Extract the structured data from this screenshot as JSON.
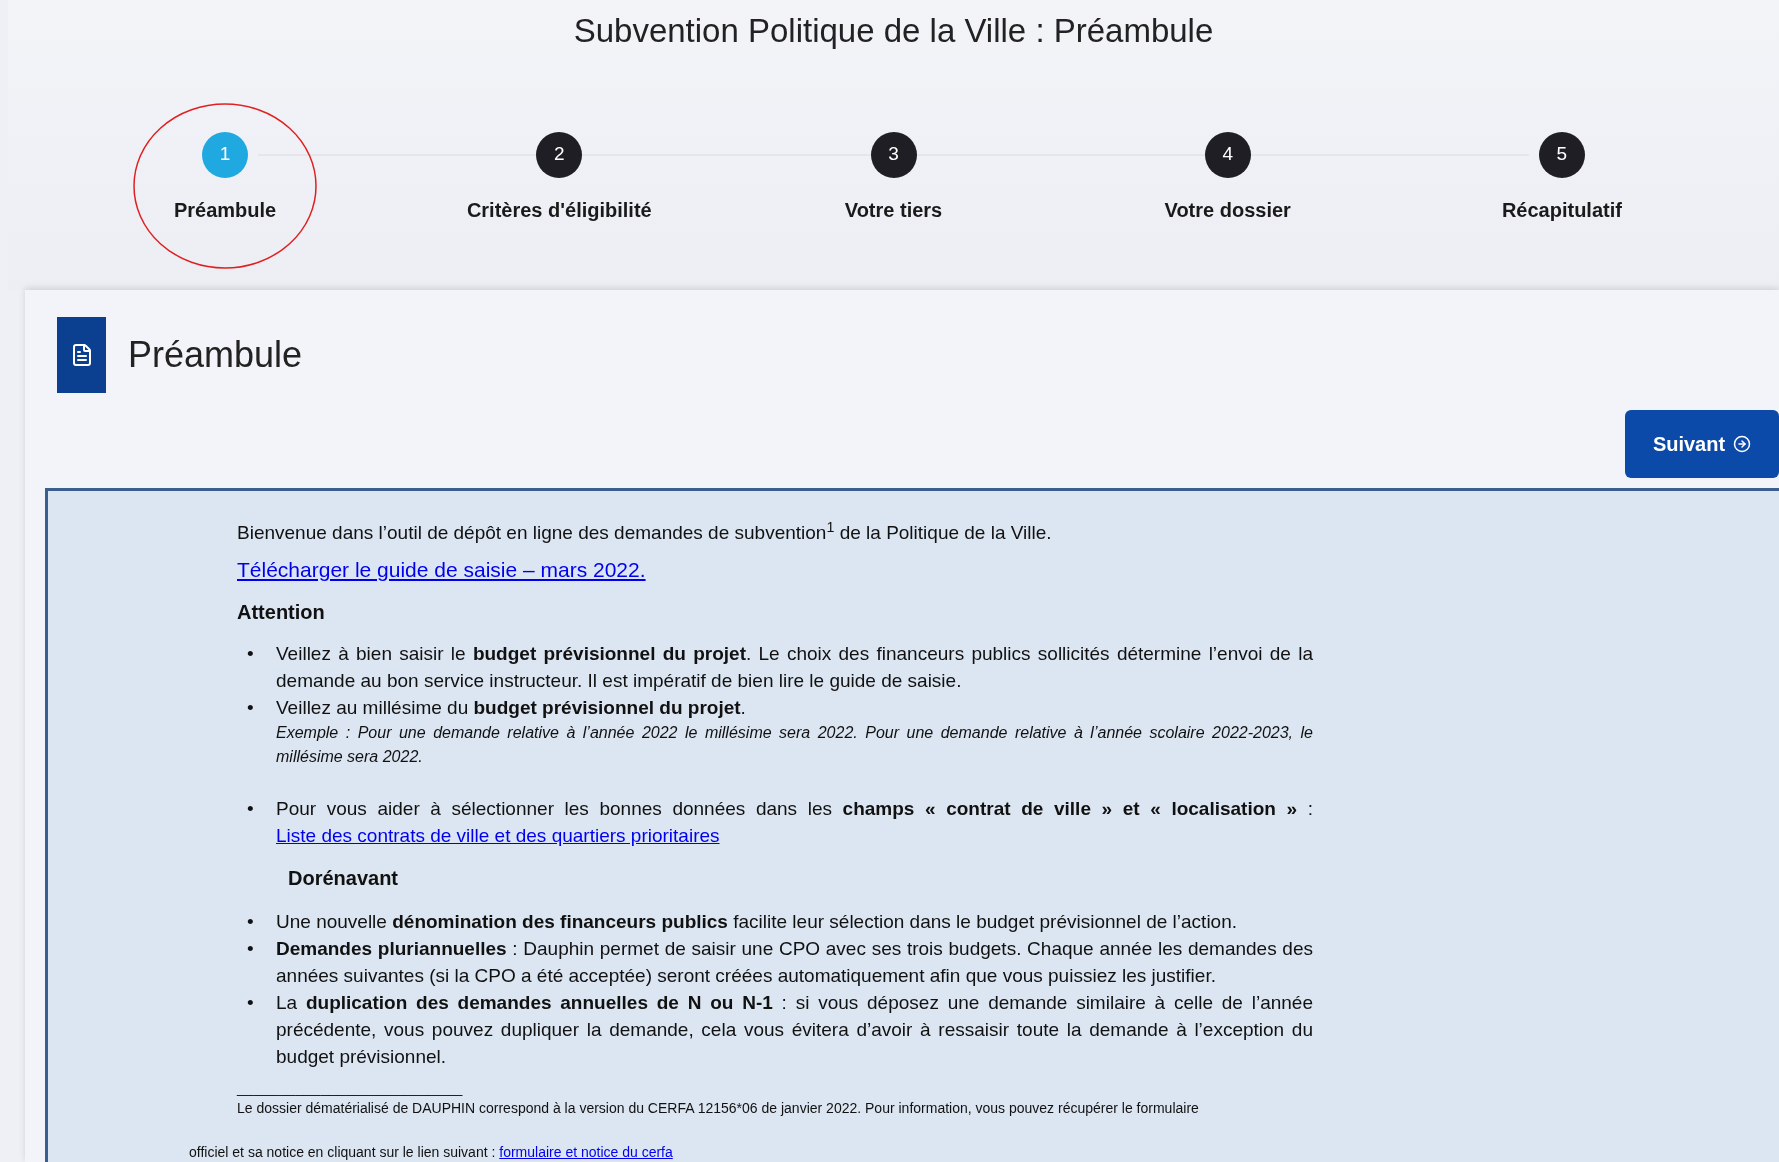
{
  "title": "Subvention Politique de la Ville : Préambule",
  "steps": [
    {
      "number": "1",
      "label": "Préambule",
      "selected": true,
      "circled": true
    },
    {
      "number": "2",
      "label": "Critères d'éligibilité",
      "selected": false,
      "circled": false
    },
    {
      "number": "3",
      "label": "Votre tiers",
      "selected": false,
      "circled": false
    },
    {
      "number": "4",
      "label": "Votre dossier",
      "selected": false,
      "circled": false
    },
    {
      "number": "5",
      "label": "Récapitulatif",
      "selected": false,
      "circled": false
    }
  ],
  "section": {
    "title": "Préambule"
  },
  "next_button": {
    "label": "Suivant"
  },
  "content": {
    "intro": "Bienvenue dans l’outil de dépôt en ligne des demandes de subvention$^{1}$ de la Politique de la Ville.",
    "guide_link": "Télécharger le guide de saisie – mars 2022.",
    "attention_heading": "Attention",
    "attention_items": [
      {
        "bullet": "•",
        "text": "Veillez à bien saisir le **budget prévisionnel du projet**. Le choix des financeurs publics sollicités détermine l’envoi de la demande au bon service instructeur. Il  est impératif de bien lire le guide de saisie."
      },
      {
        "bullet": "•",
        "text": "Veillez au millésime du **budget prévisionnel  du projet**.",
        "example": "Exemple : Pour une demande relative à l’année 2022 le millésime sera 2022. Pour une demande relative à l’année scolaire 2022-2023, le millésime sera 2022."
      },
      {
        "bullet": "•",
        "text": "Pour vous aider à sélectionner les bonnes données dans les **champs « contrat de ville » et « localisation »** :",
        "link": "Liste des contrats de ville et des quartiers prioritaires"
      }
    ],
    "dorenavant_heading": "Dorénavant",
    "dorenavant_items": [
      {
        "bullet": "•",
        "text": "Une nouvelle **dénomination des financeurs publics** facilite leur sélection dans le budget prévisionnel de l’action."
      },
      {
        "bullet": "•",
        "text": "**Demandes pluriannuelles** : Dauphin  permet de saisir une CPO avec ses trois budgets. Chaque année les demandes des années suivantes (si la CPO a été acceptée) seront créées automatiquement afin que vous puissiez les justifier."
      },
      {
        "bullet": "•",
        "text": "La **duplication des demandes annuelles de N ou N-1** : si vous déposez une demande similaire à celle de l’année précédente, vous pouvez dupliquer la demande, cela vous évitera d’avoir à ressaisir toute la demande à l’exception du budget prévisionnel."
      }
    ],
    "footnote_rule": "___________________________",
    "footnote": "Le dossier dématérialisé de DAUPHIN correspond à la version du CERFA 12156*06 de janvier 2022. Pour information, vous pouvez récupérer le formulaire",
    "footnote_continued": "officiel et sa notice en cliquant sur le lien suivant :",
    "footnote_link": "formulaire et notice du cerfa"
  }
}
